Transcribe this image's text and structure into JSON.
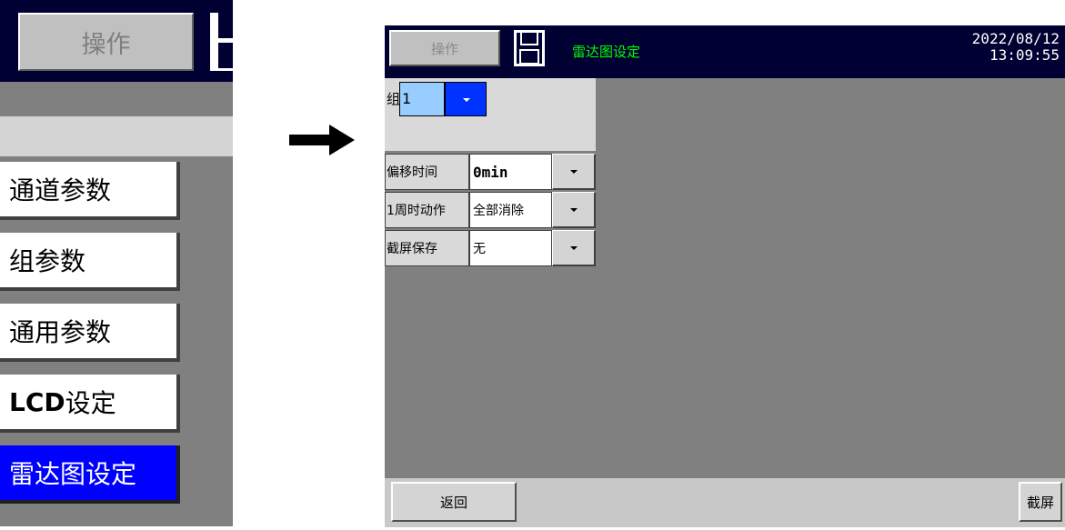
{
  "left": {
    "operate_label": "操作",
    "menu": [
      {
        "label_a": "通道参数",
        "label_b": ""
      },
      {
        "label_a": "组参数",
        "label_b": ""
      },
      {
        "label_a": "通用参数",
        "label_b": ""
      },
      {
        "label_a": "LCD",
        "label_b": "设定"
      },
      {
        "label_a": "雷达图设定",
        "label_b": ""
      }
    ],
    "selected_index": 4,
    "selected_color": "#0000ff"
  },
  "arrow_icon": "right-arrow-icon",
  "screen": {
    "operate_label": "操作",
    "save_icon": "floppy-save-icon",
    "title": "雷达图设定",
    "title_color": "#00ff00",
    "date": "2022/08/12",
    "time": "13:09:55",
    "group": {
      "label": "组",
      "value": "1"
    },
    "rows": [
      {
        "label": "偏移时间",
        "value": "0min"
      },
      {
        "label": "1周时动作",
        "value": "全部消除"
      },
      {
        "label": "截屏保存",
        "value": "无"
      }
    ],
    "back_label": "返回",
    "screenshot_label": "截屏"
  }
}
